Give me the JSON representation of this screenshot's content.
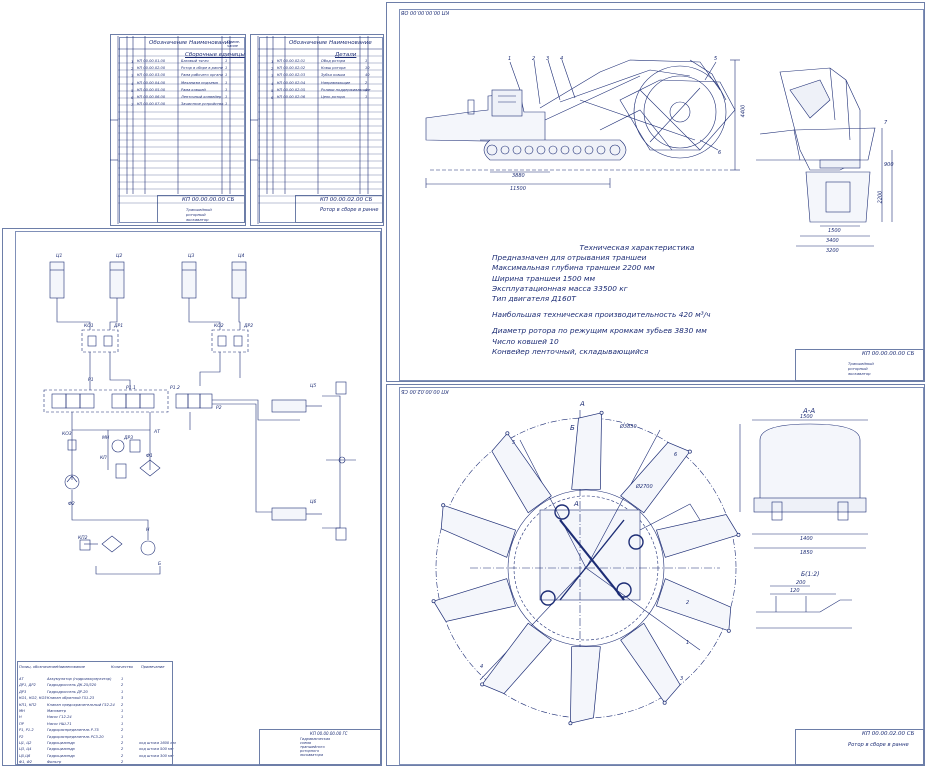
{
  "sheets": {
    "spec1": {
      "title": "КП 00.00.00.00 СБ",
      "section": "Сборочные единицы",
      "col_designation": "Обозначение",
      "col_name": "Наименование",
      "col_qty": "Кол.",
      "col_note": "Приме-чание",
      "rows": [
        {
          "pos": "1",
          "code": "КП 00.00.01.00",
          "name": "Базовый тягач",
          "qty": "1"
        },
        {
          "pos": "2",
          "code": "КП 00.00.02.00",
          "name": "Ротор в сборе в ранне",
          "qty": "1"
        },
        {
          "pos": "3",
          "code": "КП 00.00.03.00",
          "name": "Рама рабочего органа",
          "qty": "1"
        },
        {
          "pos": "4",
          "code": "КП 00.00.04.00",
          "name": "Механизм подъема",
          "qty": "1"
        },
        {
          "pos": "5",
          "code": "КП 00.00.05.00",
          "name": "Рама ковшей",
          "qty": "1"
        },
        {
          "pos": "6",
          "code": "КП 00.00.06.00",
          "name": "Ленточный конвейер",
          "qty": "1"
        },
        {
          "pos": "7",
          "code": "КП 00.00.07.00",
          "name": "Зачистное устройство",
          "qty": "1"
        }
      ],
      "doc_name": "Траншейный роторный экскаватор",
      "sheet_info": "Лист"
    },
    "spec2": {
      "title": "КП 00.00.02.00 СБ",
      "section": "Детали",
      "rows": [
        {
          "pos": "1",
          "code": "КП 00.00.02.01",
          "name": "Обод ротора",
          "qty": "1"
        },
        {
          "pos": "2",
          "code": "КП 00.00.02.02",
          "name": "Ковш ротора",
          "qty": "10"
        },
        {
          "pos": "3",
          "code": "КП 00.00.02.03",
          "name": "Зубья ковша",
          "qty": "40"
        },
        {
          "pos": "4",
          "code": "КП 00.00.02.04",
          "name": "Направляющие",
          "qty": "2"
        },
        {
          "pos": "5",
          "code": "КП 00.00.02.05",
          "name": "Ролики поддерживающие",
          "qty": "4"
        },
        {
          "pos": "6",
          "code": "КП 00.00.02.06",
          "name": "Цепь ротора",
          "qty": "1"
        }
      ],
      "doc_name": "Ротор в сборе в ранне"
    },
    "general": {
      "stamp": "КП 00.00.00.00 ОВ",
      "title": "КП 00.00.00.00 СБ",
      "doc_name": "Траншейный роторный экскаватор",
      "characteristics": {
        "title": "Техническая характеристика",
        "lines": [
          "Предназначен для отрывания траншеи",
          "Максимальная глубина траншеи  2200 мм",
          "Ширина траншеи   1500 мм",
          "Эксплуатационная масса 33500 кг",
          "Тип двигателя Д160Т",
          "Наибольшая техническая производительность 420 м³/ч",
          "Диаметр ротора по режущим кромкам зубьев  3830 мм",
          "Число ковшей 10",
          "Конвейер ленточный, складывающийся"
        ]
      },
      "dims": {
        "len_main": "11500",
        "len_track": "3880",
        "height": "4400",
        "side_w1": "3400",
        "side_w2": "3200",
        "side_w3": "1500",
        "side_h": "2200",
        "side_d": "900"
      },
      "callouts": [
        "1",
        "2",
        "3",
        "4",
        "5",
        "6",
        "7"
      ]
    },
    "hydraulic": {
      "title": "Гидравлическая схема траншейного роторного экскаватора",
      "designation": "КП 00.00.00.00 ГС",
      "components": [
        "Ц1",
        "Ц2",
        "Ц3",
        "Ц4",
        "Ц5",
        "Ц6",
        "КО1",
        "ДР1",
        "КО2",
        "ДР2",
        "Р1",
        "Р1.1",
        "Р1.2",
        "Р2",
        "КО3",
        "МН",
        "ДР3",
        "КП",
        "АТ",
        "Ф1",
        "Ф2",
        "Н",
        "Б",
        "КП2"
      ],
      "legend_header": {
        "pos": "Позиц. обозначение",
        "name": "Наименование",
        "qty": "Количество",
        "note": "Примечание"
      },
      "legend": [
        {
          "pos": "АТ",
          "name": "Аккумулятор (гидроаккумулятор)",
          "qty": "1",
          "note": ""
        },
        {
          "pos": "ДР1, ДР2",
          "name": "Гидродроссель ДК-25/320",
          "qty": "2",
          "note": ""
        },
        {
          "pos": "ДР3",
          "name": "Гидродроссель ДР-20",
          "qty": "1",
          "note": ""
        },
        {
          "pos": "КО1, КО2, КО3",
          "name": "Клапан обратный Г51-23",
          "qty": "3",
          "note": ""
        },
        {
          "pos": "КП1, КП2",
          "name": "Клапан предохранительный Г52-24",
          "qty": "2",
          "note": ""
        },
        {
          "pos": "МН",
          "name": "Манометр",
          "qty": "1",
          "note": ""
        },
        {
          "pos": "Н",
          "name": "Насос Г12-24",
          "qty": "1",
          "note": ""
        },
        {
          "pos": "ПР",
          "name": "Насос НШ-71",
          "qty": "1",
          "note": ""
        },
        {
          "pos": "Р1, Р1.2",
          "name": "Гидрораспределитель Р-75",
          "qty": "2",
          "note": ""
        },
        {
          "pos": "Р2",
          "name": "Гидрораспределитель РСЗ-20",
          "qty": "1",
          "note": ""
        },
        {
          "pos": "Ц1, Ц2",
          "name": "Гидроцилиндр",
          "qty": "2",
          "note": "ход штока 1600 мм"
        },
        {
          "pos": "Ц3, Ц4",
          "name": "Гидроцилиндр",
          "qty": "2",
          "note": "ход штока 500 мм"
        },
        {
          "pos": "Ц5,Ц6",
          "name": "Гидроцилиндр",
          "qty": "2",
          "note": "ход штока 300 мм"
        },
        {
          "pos": "Ф1, Ф2",
          "name": "Фильтр",
          "qty": "2",
          "note": ""
        }
      ]
    },
    "rotor": {
      "stamp": "КП 00.00.02.00 СБ",
      "title": "КП 00.00.02.00 СБ",
      "doc_name": "Ротор в сборе в ранне",
      "section_aa": "А-А",
      "view_b": "Б(1:2)",
      "labels": [
        "А",
        "А",
        "Б",
        "1",
        "2",
        "3",
        "4",
        "5",
        "6"
      ],
      "dims": {
        "d1": "Ø3830",
        "d2": "Ø2700",
        "w1": "1500",
        "w2": "1850",
        "w3": "1400",
        "b1": "200",
        "b2": "120"
      }
    }
  },
  "colors": {
    "line": "#1d2d75",
    "fill": "#e8ecf6",
    "frame": "#6d7ea8"
  }
}
